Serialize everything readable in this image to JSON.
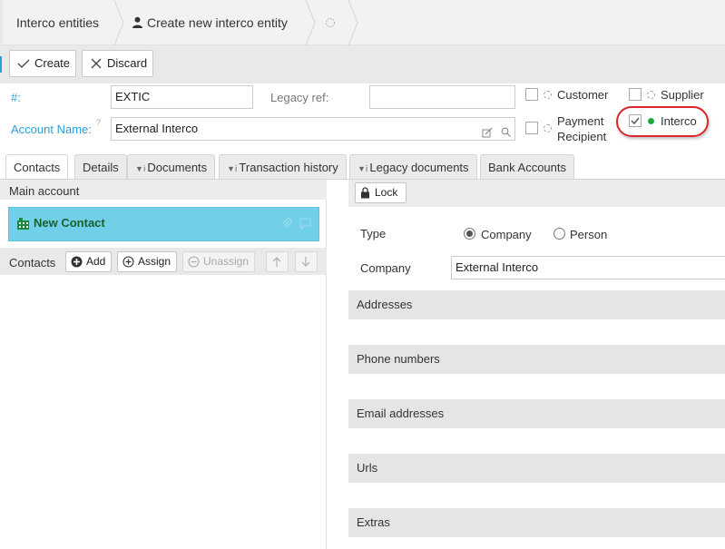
{
  "breadcrumb": {
    "items": [
      {
        "label": "Interco entities"
      },
      {
        "label": "Create new interco entity"
      }
    ]
  },
  "toolbar": {
    "create_label": "Create",
    "discard_label": "Discard"
  },
  "form": {
    "number_label": "#:",
    "number_value": "EXTIC",
    "legacy_ref_label": "Legacy ref:",
    "legacy_ref_value": "",
    "account_name_label": "Account Name:",
    "account_name_hint": "?",
    "account_name_value": "External Interco",
    "checks": {
      "customer": {
        "label": "Customer",
        "checked": false
      },
      "supplier": {
        "label": "Supplier",
        "checked": false
      },
      "payment_recipient": {
        "label_line1": "Payment",
        "label_line2": "Recipient",
        "checked": false
      },
      "interco": {
        "label": "Interco",
        "checked": true
      }
    },
    "highlight_color": "#d9262a"
  },
  "tabs": [
    {
      "label": "Contacts",
      "active": true
    },
    {
      "label": "Details"
    },
    {
      "label": "Documents"
    },
    {
      "label": "Transaction history"
    },
    {
      "label": "Legacy documents"
    },
    {
      "label": "Bank Accounts"
    }
  ],
  "left_panel": {
    "main_account_label": "Main account",
    "new_contact_label": "New Contact",
    "contacts_label": "Contacts",
    "buttons": {
      "add": "Add",
      "assign": "Assign",
      "unassign": "Unassign"
    },
    "accent_color": "#71d0e8"
  },
  "right_panel": {
    "lock_label": "Lock",
    "type_label": "Type",
    "type_options": [
      {
        "label": "Company",
        "selected": true
      },
      {
        "label": "Person",
        "selected": false
      }
    ],
    "company_label": "Company",
    "company_value": "External Interco",
    "sections": [
      "Addresses",
      "Phone numbers",
      "Email addresses",
      "Urls",
      "Extras"
    ]
  }
}
